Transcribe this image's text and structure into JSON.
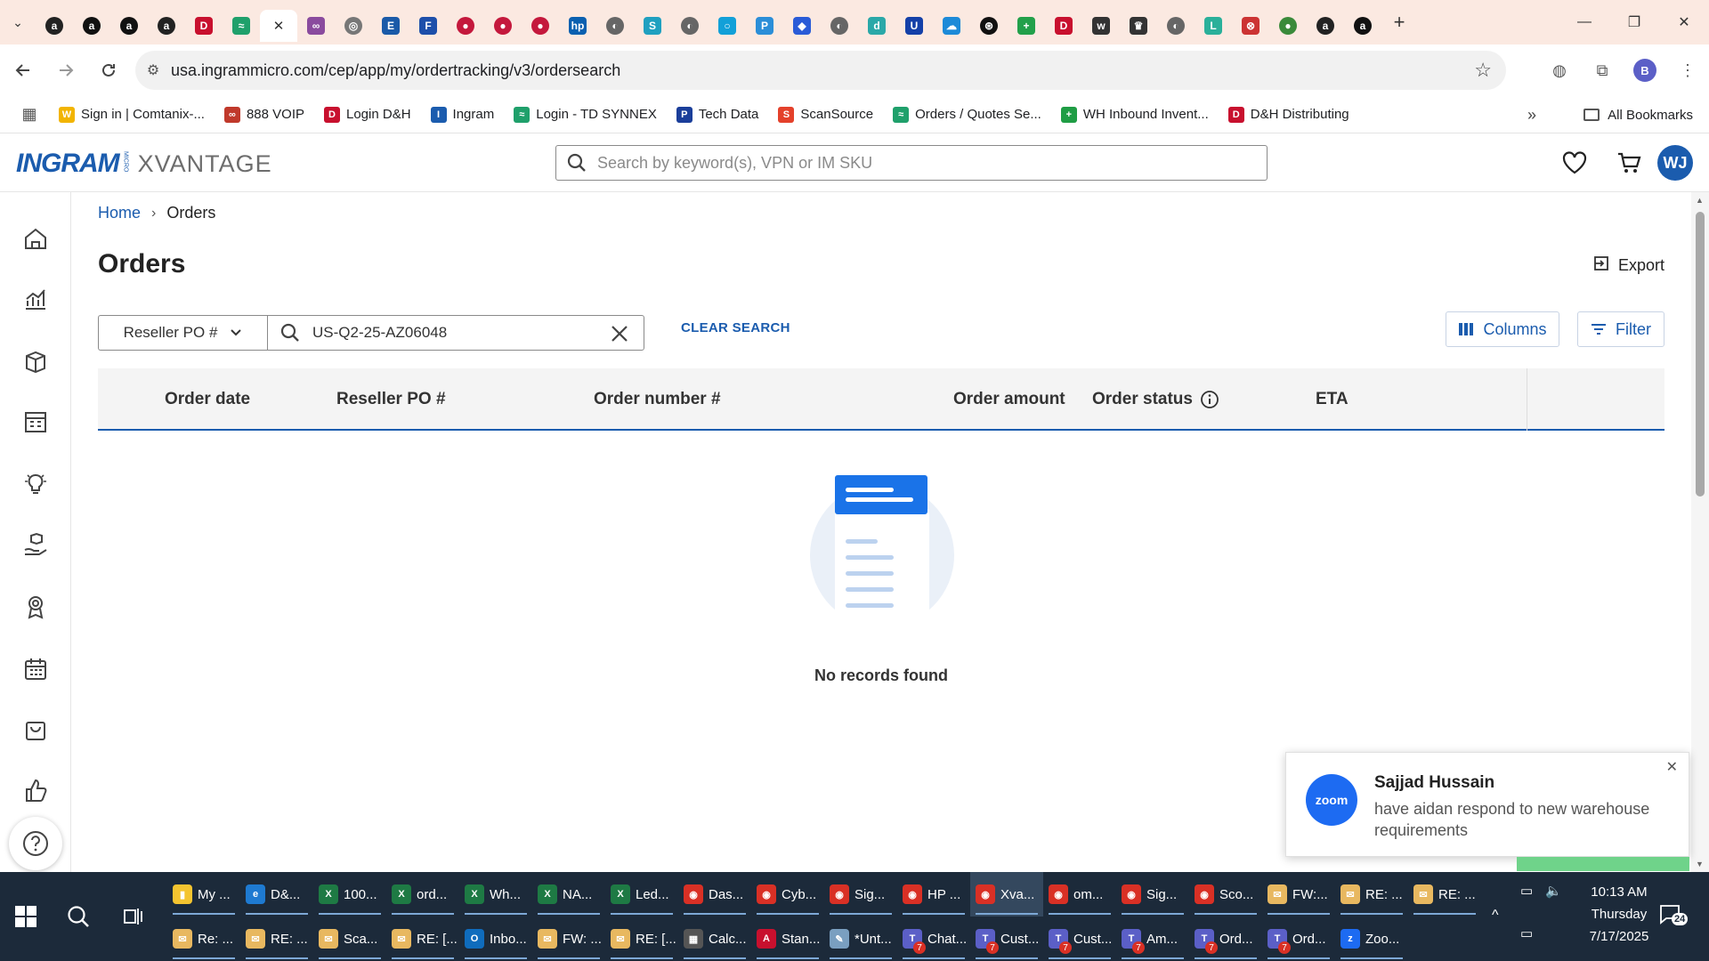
{
  "browser": {
    "tab_favicons": [
      {
        "name": "amazon-icon",
        "color": "#222",
        "glyph": "a"
      },
      {
        "name": "amazon-icon",
        "color": "#111",
        "glyph": "a"
      },
      {
        "name": "amazon-icon",
        "color": "#111",
        "glyph": "a"
      },
      {
        "name": "amazon-icon",
        "color": "#222",
        "glyph": "a"
      },
      {
        "name": "dh-icon",
        "color": "#c8102e",
        "glyph": "D"
      },
      {
        "name": "synnex-icon",
        "color": "#1fa06b",
        "glyph": "≈"
      },
      {
        "name": "scansource-icon",
        "color": "#e4412b",
        "glyph": "S"
      },
      {
        "name": "link-icon",
        "color": "#8a4b9e",
        "glyph": "∞"
      },
      {
        "name": "chrome-icon",
        "color": "#777",
        "glyph": "◎"
      },
      {
        "name": "etn-icon",
        "color": "#1a5aa8",
        "glyph": "E"
      },
      {
        "name": "f-icon",
        "color": "#1d4faa",
        "glyph": "F"
      },
      {
        "name": "lg-icon",
        "color": "#c4183c",
        "glyph": "●"
      },
      {
        "name": "lg-icon",
        "color": "#c4183c",
        "glyph": "●"
      },
      {
        "name": "lg-icon",
        "color": "#c4183c",
        "glyph": "●"
      },
      {
        "name": "hp-icon",
        "color": "#0a60b0",
        "glyph": "hp"
      },
      {
        "name": "globe-icon",
        "color": "#666",
        "glyph": "◐"
      },
      {
        "name": "synnex-icon",
        "color": "#1fa0c0",
        "glyph": "S"
      },
      {
        "name": "globe-icon",
        "color": "#666",
        "glyph": "◐"
      },
      {
        "name": "circle-icon",
        "color": "#12a0d8",
        "glyph": "○"
      },
      {
        "name": "pin-icon",
        "color": "#2b8ed8",
        "glyph": "P"
      },
      {
        "name": "diamond-icon",
        "color": "#2a5bd7",
        "glyph": "◆"
      },
      {
        "name": "globe-icon",
        "color": "#666",
        "glyph": "◐"
      },
      {
        "name": "d-icon",
        "color": "#2aa8a8",
        "glyph": "d"
      },
      {
        "name": "u-icon",
        "color": "#1440a8",
        "glyph": "U"
      },
      {
        "name": "cloud-icon",
        "color": "#1c8ad8",
        "glyph": "☁"
      },
      {
        "name": "openai-icon",
        "color": "#111",
        "glyph": "⊛"
      },
      {
        "name": "plus-icon",
        "color": "#22a04a",
        "glyph": "+"
      },
      {
        "name": "dh-icon",
        "color": "#c8102e",
        "glyph": "D"
      },
      {
        "name": "w-icon",
        "color": "#333",
        "glyph": "w"
      },
      {
        "name": "crown-icon",
        "color": "#333",
        "glyph": "♛"
      },
      {
        "name": "globe-icon",
        "color": "#666",
        "glyph": "◐"
      },
      {
        "name": "logi-icon",
        "color": "#2ab09a",
        "glyph": "L"
      },
      {
        "name": "car-icon",
        "color": "#c33",
        "glyph": "⊗"
      },
      {
        "name": "green-icon",
        "color": "#3a8a3a",
        "glyph": "●"
      },
      {
        "name": "amazon-icon",
        "color": "#222",
        "glyph": "a"
      },
      {
        "name": "amazon-icon",
        "color": "#111",
        "glyph": "a"
      }
    ],
    "active_tab_index": 6,
    "url": "usa.ingrammicro.com/cep/app/my/ordertracking/v3/ordersearch",
    "profile_initial": "B",
    "bookmarks": [
      {
        "label": "Sign in | Comtanix-...",
        "color": "#f2b400",
        "glyph": "W"
      },
      {
        "label": "888 VOIP",
        "color": "#c0392b",
        "glyph": "∞"
      },
      {
        "label": "Login D&H",
        "color": "#c8102e",
        "glyph": "D"
      },
      {
        "label": "Ingram",
        "color": "#1b5cae",
        "glyph": "I"
      },
      {
        "label": "Login - TD SYNNEX",
        "color": "#1fa06b",
        "glyph": "≈"
      },
      {
        "label": "Tech Data",
        "color": "#1a3e9a",
        "glyph": "P"
      },
      {
        "label": "ScanSource",
        "color": "#e4412b",
        "glyph": "S"
      },
      {
        "label": "Orders / Quotes Se...",
        "color": "#1fa06b",
        "glyph": "≈"
      },
      {
        "label": "WH Inbound Invent...",
        "color": "#1f9d45",
        "glyph": "+"
      },
      {
        "label": "D&H Distributing",
        "color": "#c8102e",
        "glyph": "D"
      }
    ],
    "all_bookmarks_label": "All Bookmarks"
  },
  "app": {
    "logo_text": "INGRAM",
    "logo_micro": "MICRO",
    "logo_xvantage": "XVANTAGE",
    "search_placeholder": "Search by keyword(s), VPN or IM SKU",
    "user_initials": "WJ"
  },
  "page": {
    "breadcrumb_home": "Home",
    "breadcrumb_current": "Orders",
    "title": "Orders",
    "export_label": "Export",
    "search_field_label": "Reseller PO #",
    "search_value": "US-Q2-25-AZ06048",
    "clear_search_label": "CLEAR SEARCH",
    "columns_label": "Columns",
    "filter_label": "Filter",
    "columns": [
      "Order date",
      "Reseller PO #",
      "Order number #",
      "Order amount",
      "Order status",
      "ETA"
    ],
    "empty_message": "No records found"
  },
  "toast": {
    "app_label": "zoom",
    "sender": "Sajjad Hussain",
    "message": "have aidan respond to new warehouse requirements"
  },
  "taskbar": {
    "row1": [
      {
        "label": "My ...",
        "color": "#f4c430",
        "glyph": "▮"
      },
      {
        "label": "D&...",
        "color": "#1e7ad1",
        "glyph": "e"
      },
      {
        "label": "100...",
        "color": "#1e7a44",
        "glyph": "X"
      },
      {
        "label": "ord...",
        "color": "#1e7a44",
        "glyph": "X"
      },
      {
        "label": "Wh...",
        "color": "#1e7a44",
        "glyph": "X"
      },
      {
        "label": "NA...",
        "color": "#1e7a44",
        "glyph": "X"
      },
      {
        "label": "Led...",
        "color": "#1e7a44",
        "glyph": "X"
      },
      {
        "label": "Das...",
        "color": "#d93025",
        "glyph": "◉"
      },
      {
        "label": "Cyb...",
        "color": "#d93025",
        "glyph": "◉"
      },
      {
        "label": "Sig...",
        "color": "#d93025",
        "glyph": "◉"
      },
      {
        "label": "HP ...",
        "color": "#d93025",
        "glyph": "◉"
      },
      {
        "label": "Xva...",
        "color": "#d93025",
        "glyph": "◉"
      },
      {
        "label": "om...",
        "color": "#d93025",
        "glyph": "◉"
      },
      {
        "label": "Sig...",
        "color": "#d93025",
        "glyph": "◉"
      },
      {
        "label": "Sco...",
        "color": "#d93025",
        "glyph": "◉"
      },
      {
        "label": "FW:...",
        "color": "#e8b860",
        "glyph": "✉"
      },
      {
        "label": "RE: ...",
        "color": "#e8b860",
        "glyph": "✉"
      },
      {
        "label": "RE: ...",
        "color": "#e8b860",
        "glyph": "✉"
      }
    ],
    "active_index": 11,
    "row2": [
      {
        "label": "Re: ...",
        "color": "#e8b860",
        "glyph": "✉"
      },
      {
        "label": "RE: ...",
        "color": "#e8b860",
        "glyph": "✉"
      },
      {
        "label": "Sca...",
        "color": "#e8b860",
        "glyph": "✉"
      },
      {
        "label": "RE: [...",
        "color": "#e8b860",
        "glyph": "✉"
      },
      {
        "label": "Inbo...",
        "color": "#0f6cbd",
        "glyph": "O"
      },
      {
        "label": "FW: ...",
        "color": "#e8b860",
        "glyph": "✉"
      },
      {
        "label": "RE: [...",
        "color": "#e8b860",
        "glyph": "✉"
      },
      {
        "label": "Calc...",
        "color": "#555",
        "glyph": "▦"
      },
      {
        "label": "Stan...",
        "color": "#c8102e",
        "glyph": "A"
      },
      {
        "label": "*Unt...",
        "color": "#7a9fc0",
        "glyph": "✎"
      },
      {
        "label": "Chat...",
        "color": "#5b5fc7",
        "glyph": "T"
      },
      {
        "label": "Cust...",
        "color": "#5b5fc7",
        "glyph": "T"
      },
      {
        "label": "Cust...",
        "color": "#5b5fc7",
        "glyph": "T"
      },
      {
        "label": "Am...",
        "color": "#5b5fc7",
        "glyph": "T"
      },
      {
        "label": "Ord...",
        "color": "#5b5fc7",
        "glyph": "T"
      },
      {
        "label": "Ord...",
        "color": "#5b5fc7",
        "glyph": "T"
      },
      {
        "label": "Zoo...",
        "color": "#1d6bf2",
        "glyph": "z"
      }
    ],
    "badge_count": "7",
    "time": "10:13 AM",
    "day": "Thursday",
    "date": "7/17/2025",
    "notification_count": "24"
  },
  "colors": {
    "brand": "#1b5cae",
    "tabstrip": "#fbe9e1",
    "taskbar": "#1c2a3a"
  }
}
